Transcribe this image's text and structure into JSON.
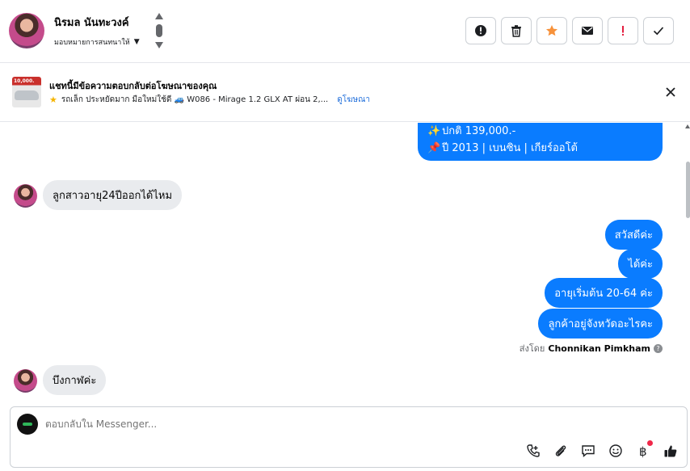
{
  "header": {
    "contact_name": "นิรมล นันทะวงค์",
    "assign_label": "มอบหมายการสนทนาให้",
    "actions": [
      {
        "name": "report",
        "icon": "alert-circle-icon"
      },
      {
        "name": "delete",
        "icon": "trash-icon"
      },
      {
        "name": "star",
        "icon": "star-icon",
        "color": "#f7923b"
      },
      {
        "name": "mark-unread",
        "icon": "envelope-icon"
      },
      {
        "name": "spam",
        "icon": "exclamation-icon",
        "color": "#e41e3f"
      },
      {
        "name": "done",
        "icon": "check-icon"
      }
    ]
  },
  "ad": {
    "title": "แชทนี้มีข้อความตอบกลับต่อโฆษณาของคุณ",
    "thumb_badge": "10,000.",
    "description": "รถเล็ก ประหยัดมาก มือใหม่ใช้ดี 🚙 W086 - Mirage 1.2 GLX AT ผ่อน 2,...",
    "link": "ดูโฆษณา"
  },
  "messages": {
    "ad_reply_line1": "ปกติ 139,000.-",
    "ad_reply_line2": "ปี 2013 | เบนซิน | เกียร์ออโต้",
    "in_1": "ลูกสาวอายุ24ปีออกได้ไหม",
    "out_1": "สวัสดีค่ะ",
    "out_2": "ได้ค่ะ",
    "out_3": "อายุเริ่มต้น 20-64 ค่ะ",
    "out_4": "ลูกค้าอยู่จังหวัดอะไรคะ",
    "sent_by_prefix": "ส่งโดย",
    "sent_by_name": "Chonnikan Pimkham",
    "in_2": "บึงกาฬค่ะ"
  },
  "composer": {
    "placeholder": "ตอบกลับใน Messenger...",
    "tools": [
      "phone-plus-icon",
      "paperclip-icon",
      "message-bubble-icon",
      "smiley-icon",
      "baht-icon",
      "thumbs-up-icon"
    ]
  },
  "colors": {
    "outgoing_bubble": "#0a7cff",
    "incoming_bubble": "#e9ebee",
    "link": "#216fdb"
  }
}
